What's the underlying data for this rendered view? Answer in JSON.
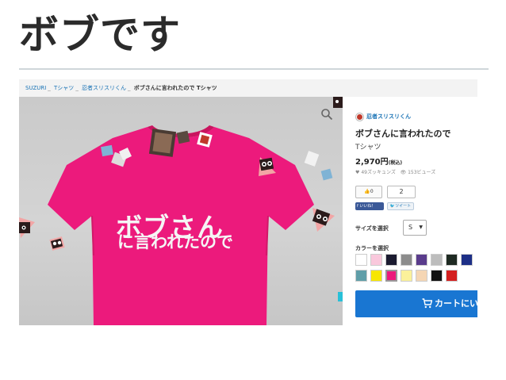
{
  "slide": {
    "title": "ボブです"
  },
  "breadcrumb": {
    "items": [
      "SUZURI",
      "Tシャツ",
      "忍者スリスリくん"
    ],
    "current": "ボブさんに言われたので Tシャツ"
  },
  "product_image": {
    "print_line1": "ボブさん",
    "print_line2": "に言われたので",
    "shirt_color": "#ec1a7c",
    "zoom_icon": "magnifier-icon"
  },
  "product": {
    "shop_name": "忍者スリスリくん",
    "title": "ボブさんに言われたので",
    "type": "Tシャツ",
    "price": "2,970円",
    "price_tax": "(税込)",
    "likes_stat": "49ズッキュンズ",
    "views_stat": "153ビューズ",
    "like_button": "0",
    "like_count": "2",
    "facebook_button": "いいね！",
    "twitter_button": "ツイート",
    "size_label": "サイズを選択",
    "size_value": "S",
    "color_label": "カラーを選択",
    "colors": [
      "#ffffff",
      "#f9c8dc",
      "#1b1b30",
      "#8c8c8c",
      "#5a3c8c",
      "#bdbdbd",
      "#1e2a22",
      "#1d2f86",
      "#5f9ea8",
      "#f7e600",
      "#ec1a7c",
      "#fbf19a",
      "#f5d6b4",
      "#111111",
      "#d41f1f"
    ],
    "cart_button": "カートにい"
  }
}
